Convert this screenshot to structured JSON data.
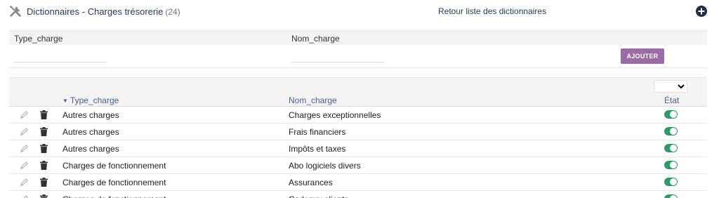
{
  "header": {
    "icon": "tools-icon",
    "title": "Dictionnaires - Charges trésorerie",
    "count": "(24)",
    "back_link": "Retour liste des dictionnaires",
    "add_icon": "plus-circle-icon"
  },
  "form": {
    "label_type": "Type_charge",
    "label_nom": "Nom_charge",
    "type_value": "",
    "nom_value": "",
    "button": "AJOUTER"
  },
  "table": {
    "filter_select": "",
    "col_type": "Type_charge",
    "col_nom": "Nom_charge",
    "col_etat": "État",
    "sort_indicator": "▼",
    "rows": [
      {
        "type": "Autres charges",
        "nom": "Charges exceptionnelles",
        "etat": "on"
      },
      {
        "type": "Autres charges",
        "nom": "Frais financiers",
        "etat": "on"
      },
      {
        "type": "Autres charges",
        "nom": "Impôts et taxes",
        "etat": "on"
      },
      {
        "type": "Charges de fonctionnement",
        "nom": "Abo logiciels divers",
        "etat": "on"
      },
      {
        "type": "Charges de fonctionnement",
        "nom": "Assurances",
        "etat": "on"
      },
      {
        "type": "Charges de fonctionnement",
        "nom": "Cadeaux clients",
        "etat": "on"
      }
    ]
  },
  "colors": {
    "accent_button": "#9b6ba5",
    "toggle_on": "#2e9a6b",
    "link": "#4a5f8a"
  }
}
